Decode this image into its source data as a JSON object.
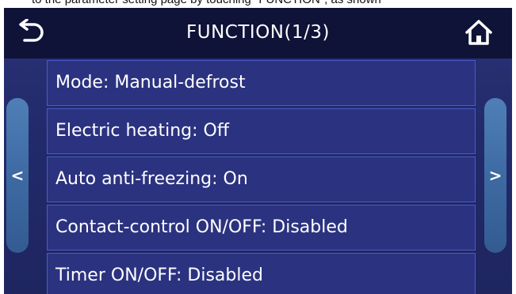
{
  "caption_text": "to the parameter setting page by touching \"FUNCTION\", as shown",
  "header": {
    "title": "FUNCTION(1/3)",
    "back_icon": "back-arrow-icon",
    "home_icon": "home-icon"
  },
  "nav": {
    "prev_glyph": "<",
    "next_glyph": ">"
  },
  "menu": {
    "items": [
      {
        "label": "Mode: Manual-defrost"
      },
      {
        "label": "Electric heating: Off"
      },
      {
        "label": "Auto anti-freezing: On"
      },
      {
        "label": "Contact-control ON/OFF: Disabled"
      },
      {
        "label": "Timer ON/OFF: Disabled"
      }
    ]
  },
  "colors": {
    "header_bg": "#0f1338",
    "screen_bg": "#232a6b",
    "item_bg": "#2b3380",
    "item_border": "#4a5bc4",
    "side_tab": "#3e6aa3",
    "text": "#ffffff"
  }
}
